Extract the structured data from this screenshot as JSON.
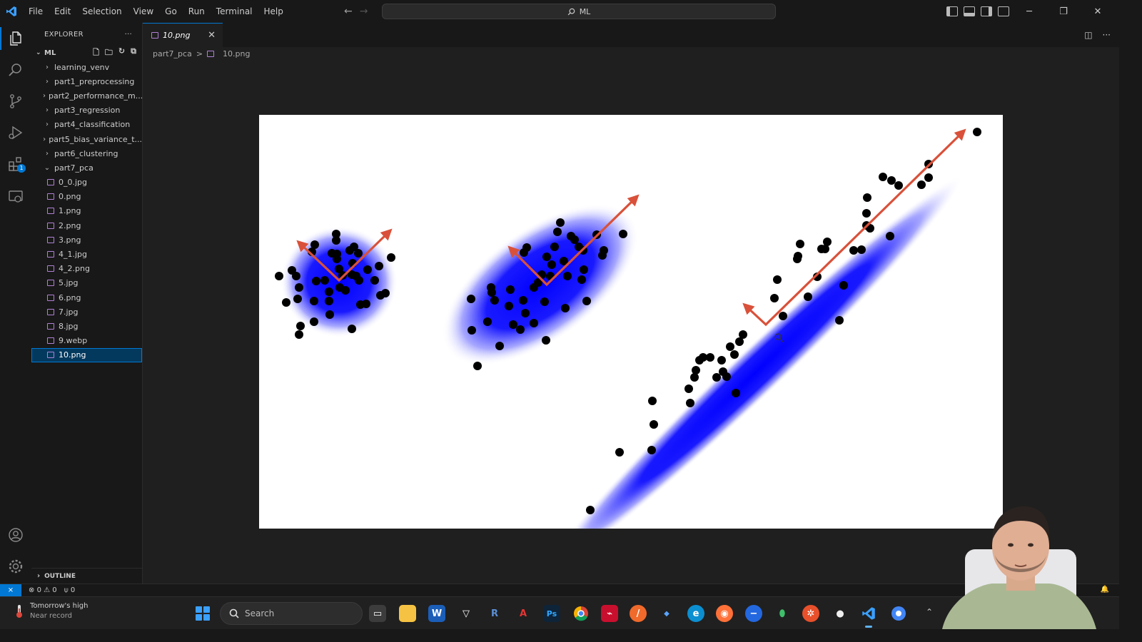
{
  "menu": [
    "File",
    "Edit",
    "Selection",
    "View",
    "Go",
    "Run",
    "Terminal",
    "Help"
  ],
  "command_center": "ML",
  "explorer": {
    "title": "EXPLORER",
    "root": "ML",
    "folders": [
      "learning_venv",
      "part1_preprocessing",
      "part2_performance_m...",
      "part3_regression",
      "part4_classification",
      "part5_bias_variance_t...",
      "part6_clustering"
    ],
    "open_folder": "part7_pca",
    "files": [
      "0_0.jpg",
      "0.png",
      "1.png",
      "2.png",
      "3.png",
      "4_1.jpg",
      "4_2.png",
      "5.jpg",
      "6.png",
      "7.jpg",
      "8.jpg",
      "9.webp",
      "10.png"
    ],
    "selected_file": "10.png",
    "outline": "OUTLINE"
  },
  "tab": {
    "label": "10.png"
  },
  "breadcrumb": {
    "folder": "part7_pca",
    "sep": ">",
    "file": "10.png"
  },
  "status": {
    "errors": "0",
    "warnings": "0",
    "ports": "0"
  },
  "taskbar": {
    "weather_title": "Tomorrow's high",
    "weather_sub": "Near record",
    "search": "Search"
  },
  "colors": {
    "accent": "#0078d4",
    "arrow": "#d9513a",
    "blob": "#0000ff"
  }
}
